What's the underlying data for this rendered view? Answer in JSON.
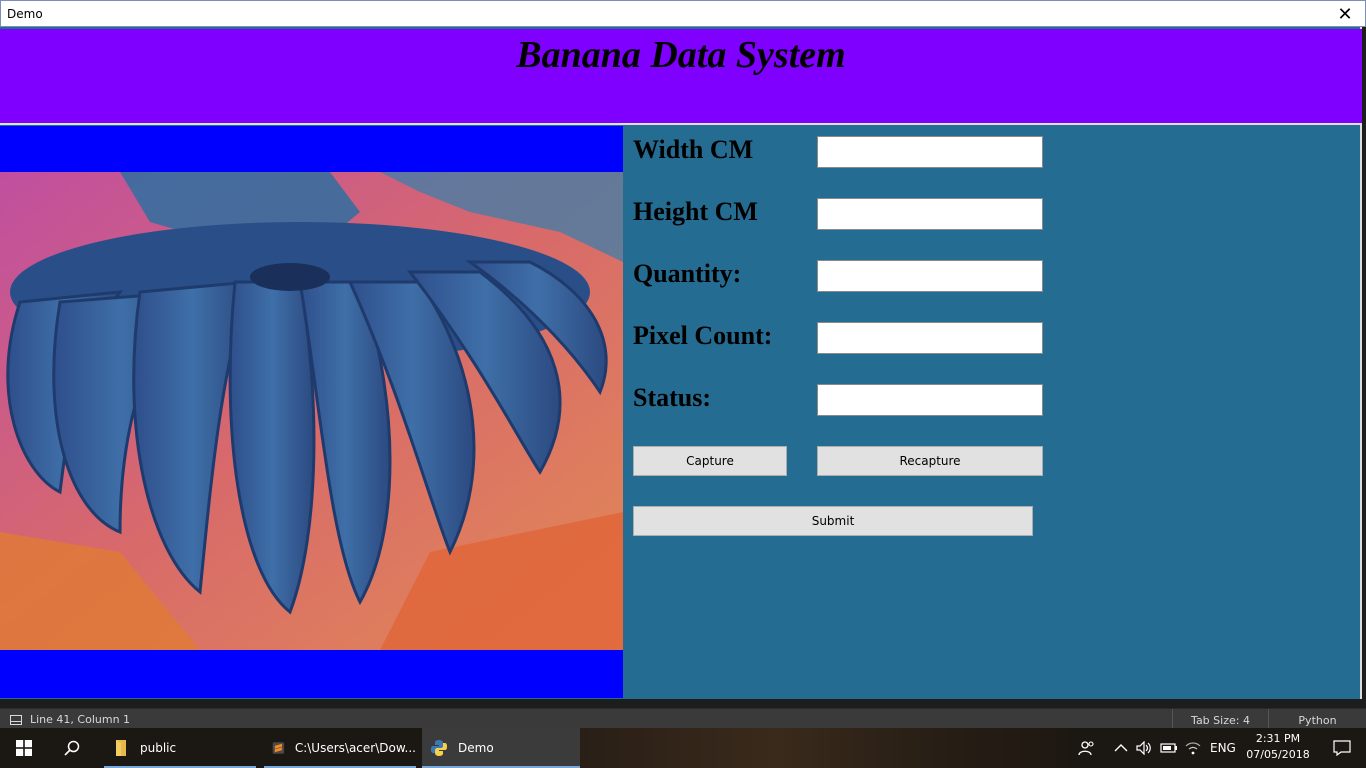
{
  "window": {
    "title": "Demo",
    "close_glyph": "✕"
  },
  "app": {
    "heading": "Banana Data System",
    "fields": [
      {
        "label": "Width CM",
        "value": ""
      },
      {
        "label": "Height CM",
        "value": ""
      },
      {
        "label": "Quantity:",
        "value": ""
      },
      {
        "label": "Pixel Count:",
        "value": ""
      },
      {
        "label": "Status:",
        "value": ""
      }
    ],
    "buttons": {
      "capture": "Capture",
      "recapture": "Recapture",
      "submit": "Submit"
    },
    "colors": {
      "header": "#7f00ff",
      "panel": "#246c91",
      "camera_bg": "#0000ff"
    }
  },
  "editor_status": {
    "position": "Line 41, Column 1",
    "tab_size": "Tab Size: 4",
    "language": "Python"
  },
  "taskbar": {
    "apps": [
      {
        "label": "public",
        "icon": "folder-icon"
      },
      {
        "label": "C:\\Users\\acer\\Dow...",
        "icon": "sublime-text-icon"
      },
      {
        "label": "Demo",
        "icon": "python-icon"
      }
    ],
    "language": "ENG",
    "time": "2:31 PM",
    "date": "07/05/2018"
  }
}
